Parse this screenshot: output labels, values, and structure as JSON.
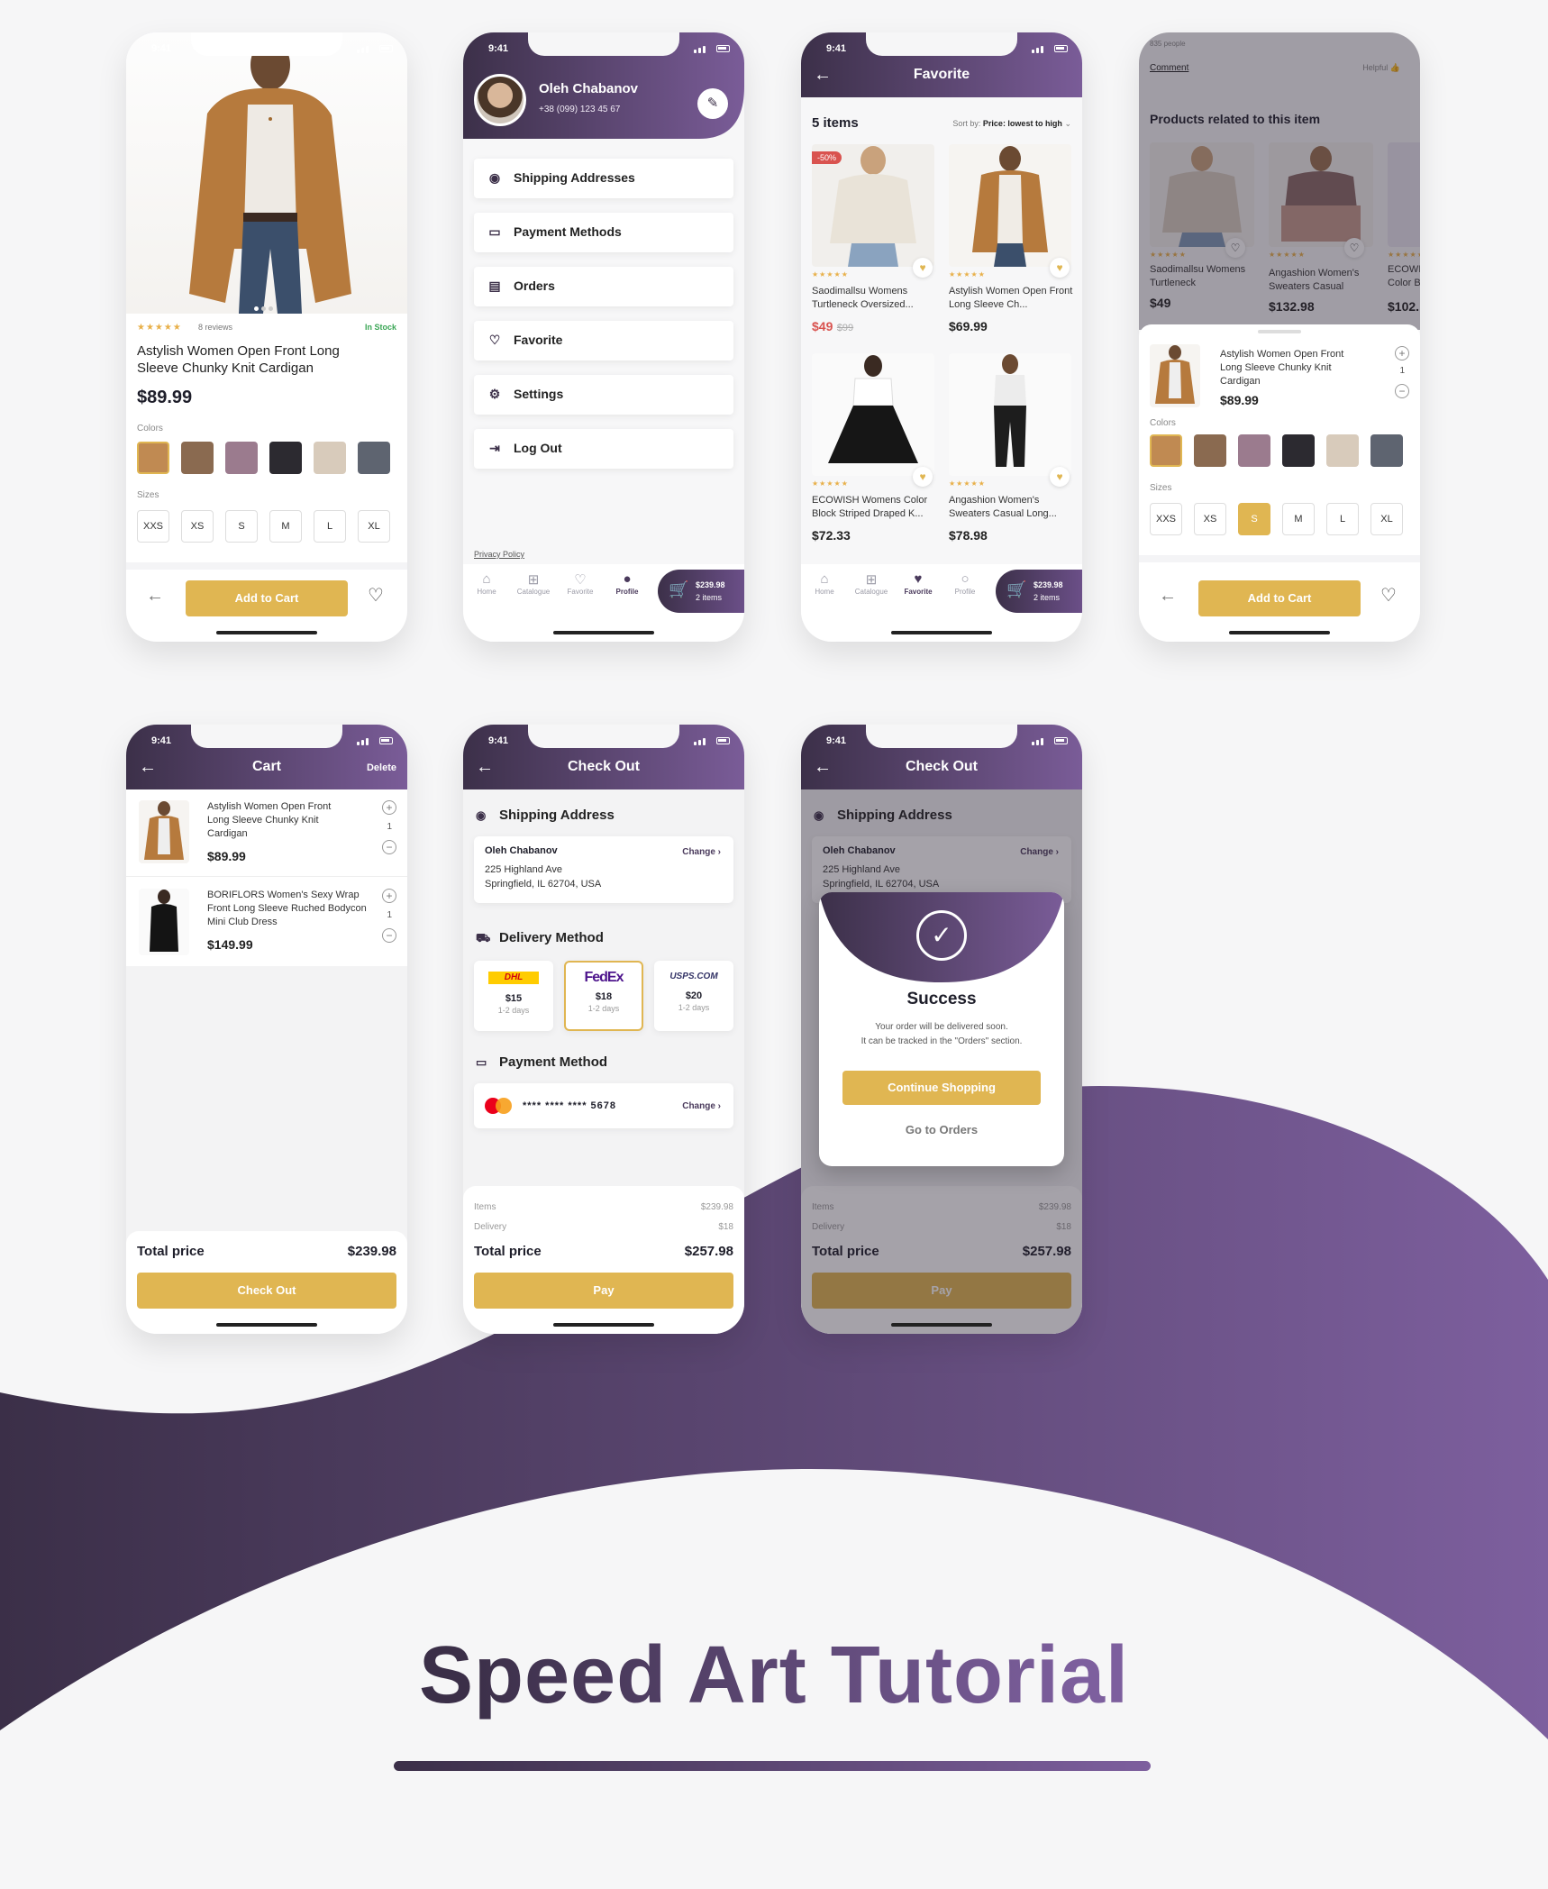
{
  "status_time": "9:41",
  "colors": {
    "purple_dark": "#3c3049",
    "purple": "#7a5c98",
    "gold": "#e0b652",
    "sale": "#d9534f",
    "green": "#3aa655"
  },
  "product": {
    "reviews": "8 reviews",
    "stock": "In Stock",
    "name": "Astylish Women Open Front Long Sleeve Chunky Knit Cardigan",
    "price": "$89.99",
    "colors_label": "Colors",
    "sizes_label": "Sizes",
    "sizes": [
      "XXS",
      "XS",
      "S",
      "M",
      "L",
      "XL"
    ],
    "add_to_cart": "Add to Cart",
    "rating": 5
  },
  "profile": {
    "name": "Oleh Chabanov",
    "phone": "+38 (099) 123 45 67",
    "menu": [
      "Shipping Addresses",
      "Payment Methods",
      "Orders",
      "Favorite",
      "Settings",
      "Log Out"
    ],
    "privacy": "Privacy Policy"
  },
  "tabs": [
    "Home",
    "Catalogue",
    "Favorite",
    "Profile"
  ],
  "cart_pill": {
    "total": "$239.98",
    "items": "2 items"
  },
  "favorite": {
    "title": "Favorite",
    "count": "5 items",
    "sort_label": "Sort by:",
    "sort_value": "Price: lowest to high",
    "discount": "-50%",
    "items": [
      {
        "name": "Saodimallsu Womens Turtleneck Oversized...",
        "price": "$49",
        "old": "$99"
      },
      {
        "name": "Astylish Women Open Front Long Sleeve Ch...",
        "price": "$69.99",
        "old": ""
      },
      {
        "name": "ECOWISH Womens Color Block Striped Draped K...",
        "price": "$72.33",
        "old": ""
      },
      {
        "name": "Angashion Women's Sweaters Casual Long...",
        "price": "$78.98",
        "old": ""
      }
    ]
  },
  "related": {
    "people": "835 people",
    "comment": "Comment",
    "helpful": "Helpful",
    "title": "Products related to this item",
    "items": [
      {
        "name": "Saodimallsu Womens Turtleneck",
        "price": "$49"
      },
      {
        "name": "Angashion Women's Sweaters Casual",
        "price": "$132.98"
      },
      {
        "name": "ECOWI Color B",
        "price": "$102."
      }
    ],
    "sheet": {
      "name": "Astylish Women Open Front Long Sleeve Chunky Knit Cardigan",
      "price": "$89.99",
      "qty": "1",
      "selected_size": "S"
    }
  },
  "cart": {
    "title": "Cart",
    "delete": "Delete",
    "items": [
      {
        "name": "Astylish Women Open Front Long Sleeve Chunky Knit Cardigan",
        "price": "$89.99",
        "qty": "1"
      },
      {
        "name": "BORIFLORS Women's Sexy Wrap Front Long Sleeve Ruched Bodycon Mini Club Dress",
        "price": "$149.99",
        "qty": "1"
      }
    ],
    "total_label": "Total price",
    "total": "$239.98",
    "checkout": "Check Out"
  },
  "checkout": {
    "title": "Check Out",
    "shipping_title": "Shipping Address",
    "name": "Oleh Chabanov",
    "addr1": "225 Highland Ave",
    "addr2": "Springfield, IL 62704, USA",
    "change": "Change",
    "delivery_title": "Delivery Method",
    "carriers": [
      {
        "logo": "DHL",
        "price": "$15",
        "days": "1-2 days"
      },
      {
        "logo": "FedEx",
        "price": "$18",
        "days": "1-2 days"
      },
      {
        "logo": "USPS.COM",
        "price": "$20",
        "days": "1-2 days"
      }
    ],
    "payment_title": "Payment Method",
    "card": "**** **** **** 5678",
    "items_label": "Items",
    "items_value": "$239.98",
    "delivery_label": "Delivery",
    "delivery_value": "$18",
    "total_label": "Total price",
    "total": "$257.98",
    "pay": "Pay"
  },
  "success": {
    "title": "Success",
    "line1": "Your order will be delivered soon.",
    "line2": "It can be tracked in the \"Orders\" section.",
    "continue": "Continue Shopping",
    "orders": "Go to Orders"
  },
  "banner": {
    "title": "Speed Art Tutorial"
  }
}
